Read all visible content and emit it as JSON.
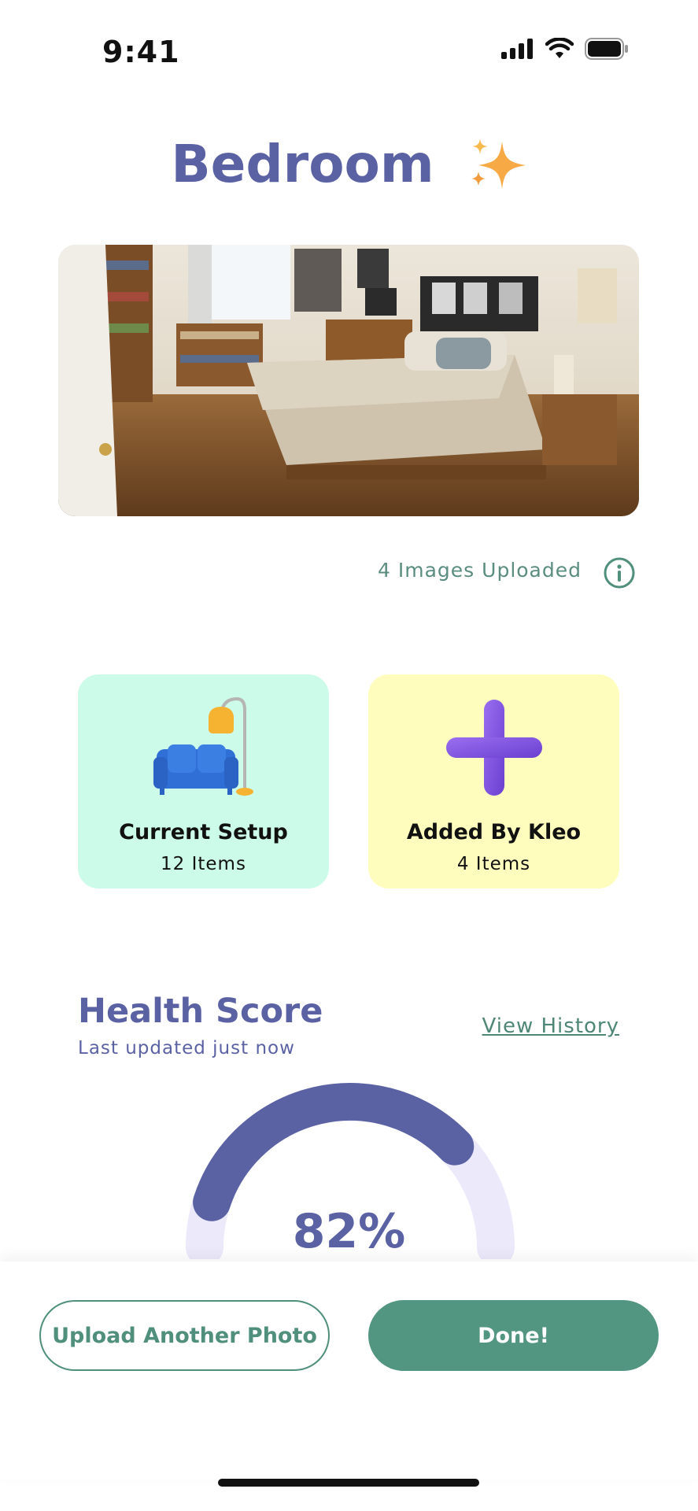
{
  "status_bar": {
    "time": "9:41"
  },
  "header": {
    "title": "Bedroom",
    "sparkle_icon": "sparkles-icon"
  },
  "photo": {
    "alt": "bedroom photo"
  },
  "uploads": {
    "label": "4 Images Uploaded",
    "info_icon": "info-icon"
  },
  "cards": [
    {
      "title": "Current Setup",
      "subtitle": "12 Items",
      "icon": "sofa-lamp-icon",
      "color": "#cdfbe9"
    },
    {
      "title": "Added By Kleo",
      "subtitle": "4 Items",
      "icon": "plus-icon",
      "color": "#fffdbd"
    }
  ],
  "health": {
    "title": "Health Score",
    "subtitle": "Last updated just now",
    "view_history": "View History",
    "score_text": "82%",
    "score": 82
  },
  "buttons": {
    "upload": "Upload Another Photo",
    "done": "Done!"
  },
  "colors": {
    "accent": "#5b62a4",
    "primary_green": "#529581"
  }
}
